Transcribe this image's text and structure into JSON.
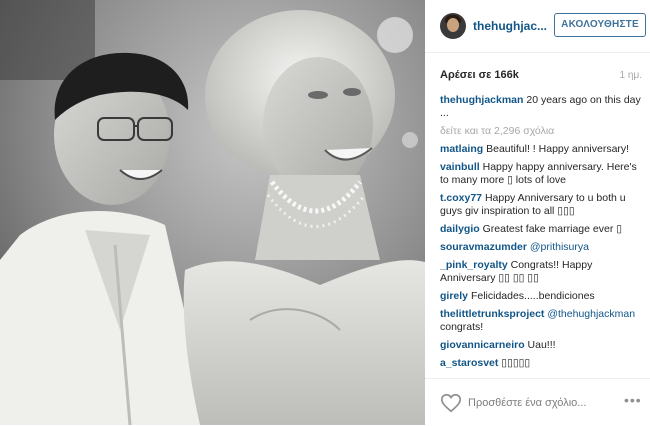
{
  "header": {
    "username": "thehughjac...",
    "follow_label": "ΑΚΟΛΟΥΘΗΣΤΕ"
  },
  "stats": {
    "likes": "Αρέσει σε 166k",
    "time": "1 ημ."
  },
  "caption": {
    "user": "thehughjackman",
    "text": "20 years ago on this day ..."
  },
  "view_all": "δείτε και τα 2,296 σχόλια",
  "comments": [
    {
      "user": "matlaing",
      "text": "Beautiful! ! Happy anniversary!"
    },
    {
      "user": "vainbull",
      "text": "Happy happy anniversary. Here's to many more ▯ lots of love"
    },
    {
      "user": "t.coxy77",
      "text": "Happy Anniversary to u both u guys giv inspiration to all ▯▯▯"
    },
    {
      "user": "dailygio",
      "text": "Greatest fake marriage ever ▯"
    },
    {
      "user": "souravmazumder",
      "mention": "@prithisurya"
    },
    {
      "user": "_pink_royalty",
      "text": "Congrats!! Happy Anniversary ▯▯ ▯▯ ▯▯"
    },
    {
      "user": "girely",
      "text": "Felicidades.....bendiciones"
    },
    {
      "user": "thelittletrunksproject",
      "mention": "@thehughjackman",
      "after": "congrats!"
    },
    {
      "user": "giovannicarneiro",
      "text": "Uau!!!"
    },
    {
      "user": "a_starosvet",
      "text": "▯▯▯▯▯"
    }
  ],
  "footer": {
    "add_comment": "Προσθέστε ένα σχόλιο...",
    "more": "•••"
  },
  "icons": {
    "heart": "heart-icon",
    "avatar": "avatar",
    "more": "ellipsis-icon"
  }
}
